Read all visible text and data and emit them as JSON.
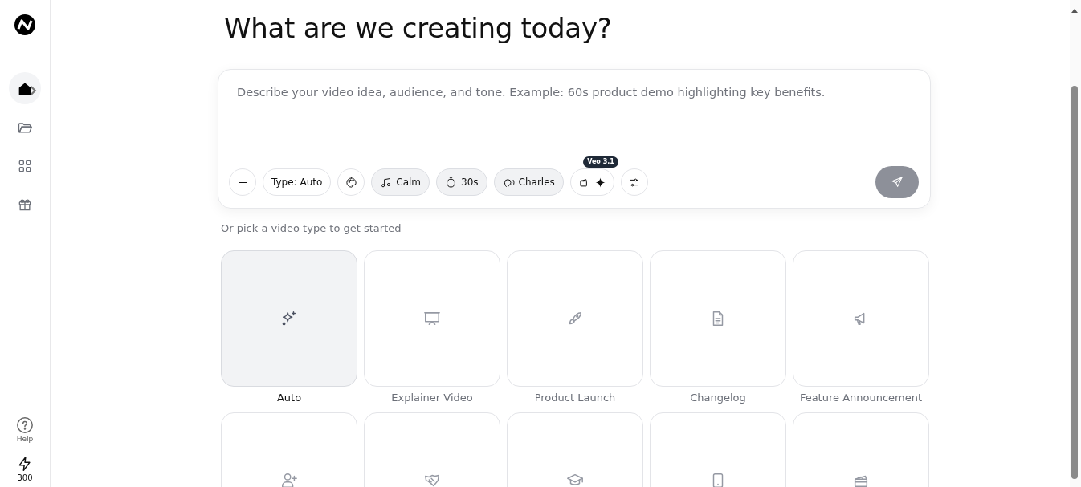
{
  "sidebar": {
    "nav": [
      {
        "selected": true
      },
      {
        "selected": false
      },
      {
        "selected": false
      },
      {
        "selected": false
      }
    ],
    "help_label": "Help",
    "credits": "300"
  },
  "title": "What are we creating today?",
  "prompt": {
    "placeholder": "Describe your video idea, audience, and tone. Example: 60s product demo highlighting key benefits.",
    "chips": [
      {
        "kind": "icon",
        "active": false
      },
      {
        "kind": "text",
        "label": "Type: Auto",
        "active": false
      },
      {
        "kind": "icon",
        "active": false
      },
      {
        "kind": "icon-text",
        "label": "Calm",
        "active": true
      },
      {
        "kind": "icon-text",
        "label": "30s",
        "active": true
      },
      {
        "kind": "icon-text",
        "label": "Charles",
        "active": true
      },
      {
        "kind": "model",
        "badge": "Veo 3.1",
        "active": false
      },
      {
        "kind": "icon",
        "active": false
      }
    ],
    "send_disabled": true
  },
  "hint": "Or pick a video type to get started",
  "video_types": [
    {
      "label": "Auto",
      "selected": true
    },
    {
      "label": "Explainer Video",
      "selected": false
    },
    {
      "label": "Product Launch",
      "selected": false
    },
    {
      "label": "Changelog",
      "selected": false
    },
    {
      "label": "Feature Announcement",
      "selected": false
    },
    {
      "selected": false
    },
    {
      "selected": false
    },
    {
      "selected": false
    },
    {
      "selected": false
    },
    {
      "selected": false
    }
  ]
}
